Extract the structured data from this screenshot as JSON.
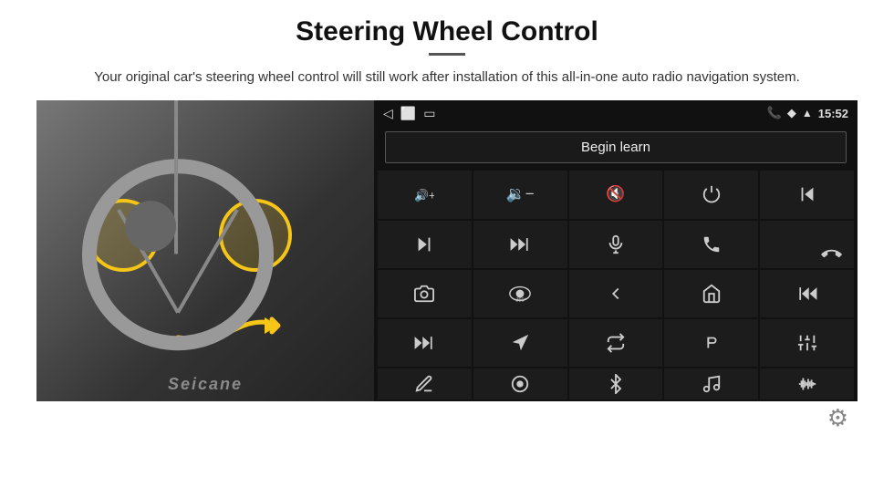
{
  "page": {
    "title": "Steering Wheel Control",
    "subtitle": "Your original car's steering wheel control will still work after installation of this all-in-one auto radio navigation system."
  },
  "status_bar": {
    "time": "15:52",
    "back_icon": "◁",
    "home_icon": "⬜",
    "recents_icon": "▭"
  },
  "begin_learn": {
    "label": "Begin learn"
  },
  "controls": [
    {
      "id": "vol-up",
      "icon": "🔊+",
      "unicode": "vol_up"
    },
    {
      "id": "vol-down",
      "icon": "🔉−",
      "unicode": "vol_down"
    },
    {
      "id": "vol-mute",
      "icon": "🔇",
      "unicode": "vol_mute"
    },
    {
      "id": "power",
      "icon": "⏻",
      "unicode": "power"
    },
    {
      "id": "prev-track",
      "icon": "⏮",
      "unicode": "prev"
    },
    {
      "id": "next",
      "icon": "⏭",
      "unicode": "next"
    },
    {
      "id": "skip-fwd",
      "icon": "⏭⏭",
      "unicode": "skip"
    },
    {
      "id": "mic",
      "icon": "🎤",
      "unicode": "mic"
    },
    {
      "id": "phone",
      "icon": "📞",
      "unicode": "phone"
    },
    {
      "id": "hang-up",
      "icon": "📵",
      "unicode": "hangup"
    },
    {
      "id": "cam",
      "icon": "📷",
      "unicode": "cam"
    },
    {
      "id": "360",
      "icon": "👁",
      "unicode": "360"
    },
    {
      "id": "back",
      "icon": "↩",
      "unicode": "back"
    },
    {
      "id": "home2",
      "icon": "🏠",
      "unicode": "home"
    },
    {
      "id": "rewind",
      "icon": "⏮⏮",
      "unicode": "rewind"
    },
    {
      "id": "fast-fwd",
      "icon": "⏭⏭",
      "unicode": "fastfwd"
    },
    {
      "id": "nav",
      "icon": "▶",
      "unicode": "nav"
    },
    {
      "id": "switch",
      "icon": "⇄",
      "unicode": "switch"
    },
    {
      "id": "record",
      "icon": "⏺",
      "unicode": "record"
    },
    {
      "id": "eq",
      "icon": "🎛",
      "unicode": "eq"
    },
    {
      "id": "pencil",
      "icon": "✏",
      "unicode": "pencil"
    },
    {
      "id": "knob",
      "icon": "⏺",
      "unicode": "knob"
    },
    {
      "id": "bt",
      "icon": "⚡",
      "unicode": "bt"
    },
    {
      "id": "music",
      "icon": "🎵",
      "unicode": "music"
    },
    {
      "id": "waveform",
      "icon": "🎚",
      "unicode": "wave"
    }
  ],
  "settings": {
    "gear_label": "⚙"
  },
  "seicane": {
    "label": "Seicane"
  }
}
